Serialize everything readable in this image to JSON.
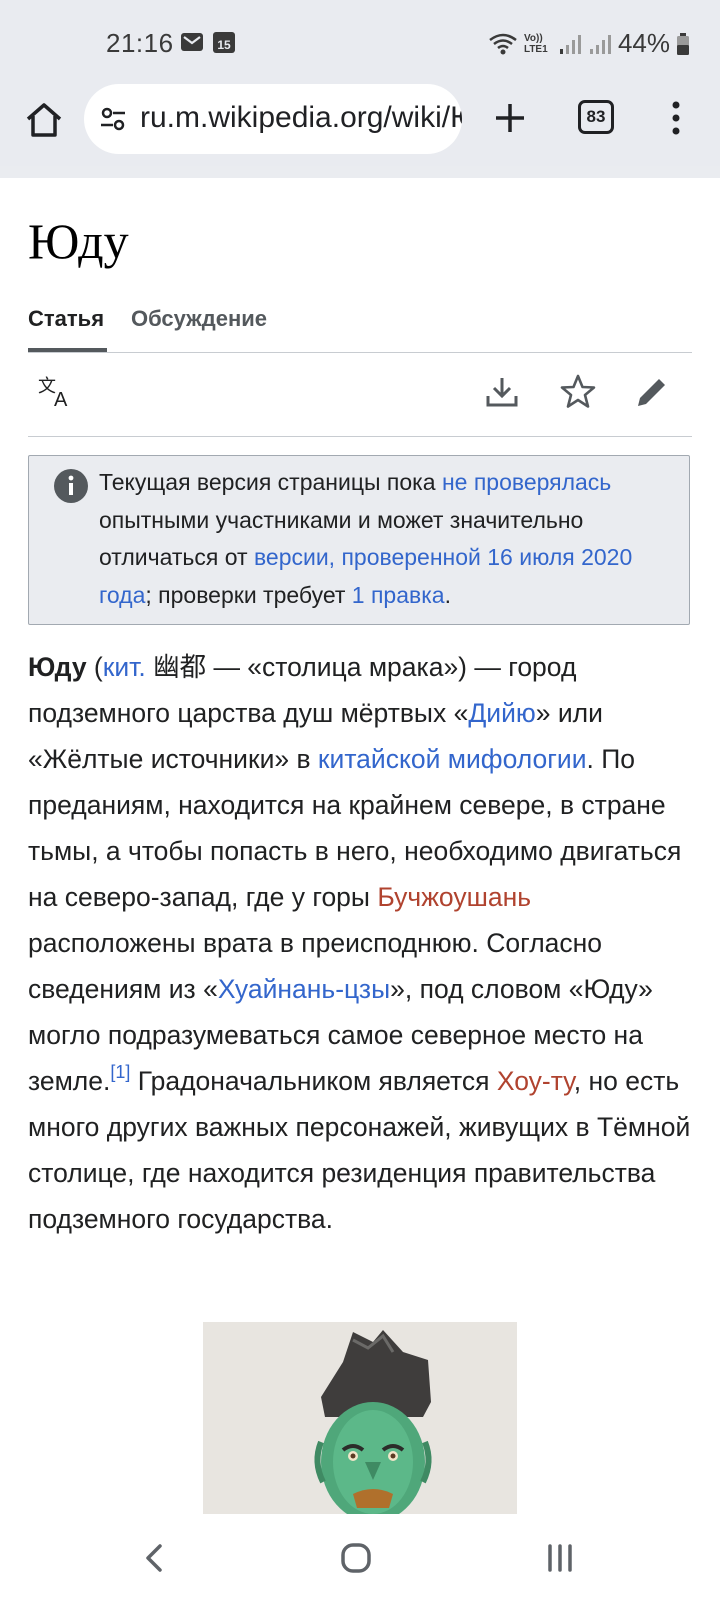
{
  "status_bar": {
    "time": "21:16",
    "battery_percent": "44%",
    "icons": [
      "gmail-icon",
      "calendar-15-icon",
      "wifi-icon",
      "volte-lte1-icon",
      "signal-icon",
      "signal-2-icon",
      "battery-icon"
    ],
    "volte_label": "Vo)) LTE1",
    "calendar_day": "15"
  },
  "browser": {
    "url": "ru.m.wikipedia.org/wiki/Юду",
    "tab_count": "83"
  },
  "page": {
    "title": "Юду",
    "tabs": [
      {
        "label": "Статья",
        "active": true
      },
      {
        "label": "Обсуждение",
        "active": false
      }
    ]
  },
  "notice": {
    "t1": "Текущая версия страницы пока ",
    "link1": "не проверялась",
    "t2": " опытными участниками и может значительно отличаться от ",
    "link2": "версии, проверенной 16 июля 2020 года",
    "t3": "; проверки требует ",
    "link3": "1 правка",
    "t4": "."
  },
  "article": {
    "bold": "Юду",
    "p1": " (",
    "l_kit": "кит.",
    "p2": " 幽都 — «столица мрака») — город подземного царства душ мёртвых «",
    "l_diyu": "Дийю",
    "p3": "» или «Жёлтые источники» в ",
    "l_myth": "китайской мифологии",
    "p4": ". По преданиям, находится на крайнем севере, в стране тьмы, а чтобы попасть в него, необходимо двигаться на северо-запад, где у горы ",
    "l_buch": "Бучжоушань",
    "p5": " расположены врата в преисподнюю. Согласно сведениям из «",
    "l_huai": "Хуайнань-цзы",
    "p6": "», под словом «Юду» могло подразумеваться самое северное место на земле.",
    "ref": "[1]",
    "p7": " Градоначальником является ",
    "l_hou": "Хоу-ту",
    "p8": ", но есть много других важных персонажей, живущих в Тёмной столице, где находится резиденция правительства подземного государства."
  },
  "colors": {
    "link": "#3366cc",
    "redlink": "#b0432f",
    "chrome_bg": "#e9ebf0",
    "notice_bg": "#eaecf0"
  }
}
